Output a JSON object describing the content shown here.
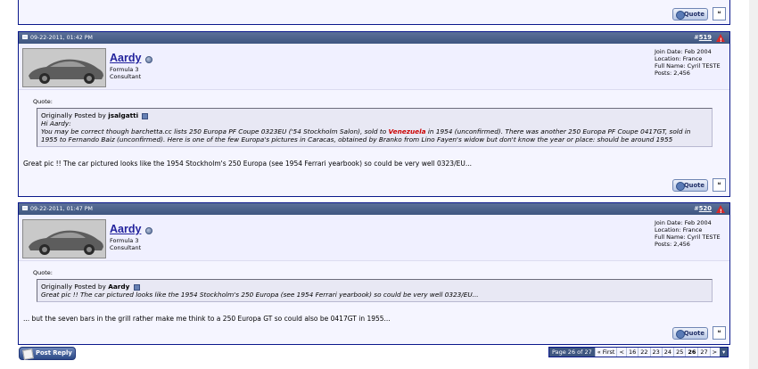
{
  "posts": [
    {
      "date": "09-22-2011, 01:42 PM",
      "number_prefix": "#",
      "number": "519",
      "username": "Aardy",
      "title_line1": "Formula 3",
      "title_line2": "Consultant",
      "join_date": "Join Date: Feb 2004",
      "location": "Location: France",
      "full_name": "Full Name: Cyril TESTE",
      "posts": "Posts: 2,456",
      "quote_label": "Quote:",
      "quote_by_prefix": "Originally Posted by",
      "quote_by": "jsalgatti",
      "quote_text_part1": "Hi Aardy:",
      "quote_text_part2": "You may be correct though barchetta.cc lists 250 Europa PF Coupe 0323EU ('54 Stockholm Salon), sold to",
      "quote_red": "Venezuela",
      "quote_text_part3": "in 1954 (unconfirmed). There was another 250 Europa PF Coupe 0417GT, sold in 1955 to Fernando Baiz (unconfirmed). Here is one of the few Europa's pictures in Caracas, obtained by Branko from Lino Fayen's widow but don't know the year or place: should be around 1955",
      "message": "Great pic !! The car pictured looks like the 1954 Stockholm's 250 Europa (see 1954 Ferrari yearbook) so could be very well 0323/EU..."
    },
    {
      "date": "09-22-2011, 01:47 PM",
      "number_prefix": "#",
      "number": "520",
      "username": "Aardy",
      "title_line1": "Formula 3",
      "title_line2": "Consultant",
      "join_date": "Join Date: Feb 2004",
      "location": "Location: France",
      "full_name": "Full Name: Cyril TESTE",
      "posts": "Posts: 2,456",
      "quote_label": "Quote:",
      "quote_by_prefix": "Originally Posted by",
      "quote_by": "Aardy",
      "quote_text": "Great pic !! The car pictured looks like the 1954 Stockholm's 250 Europa (see 1954 Ferrari yearbook) so could be very well 0323/EU...",
      "message": "... but the seven bars in the grill rather make me think to a 250 Europa GT so could also be 0417GT in 1955..."
    }
  ],
  "buttons": {
    "quote": "Quote",
    "post_reply": "Post Reply"
  },
  "pagenav": {
    "label": "Page 26 of 27",
    "first": "« First",
    "prev": "<",
    "pages": [
      "16",
      "22",
      "23",
      "24",
      "25"
    ],
    "current": "26",
    "next_page": "27",
    "next": ">"
  },
  "colors": {
    "header": "#3e5680",
    "border": "#0b198c",
    "username": "#22229c",
    "quote_red": "#cc0000"
  }
}
